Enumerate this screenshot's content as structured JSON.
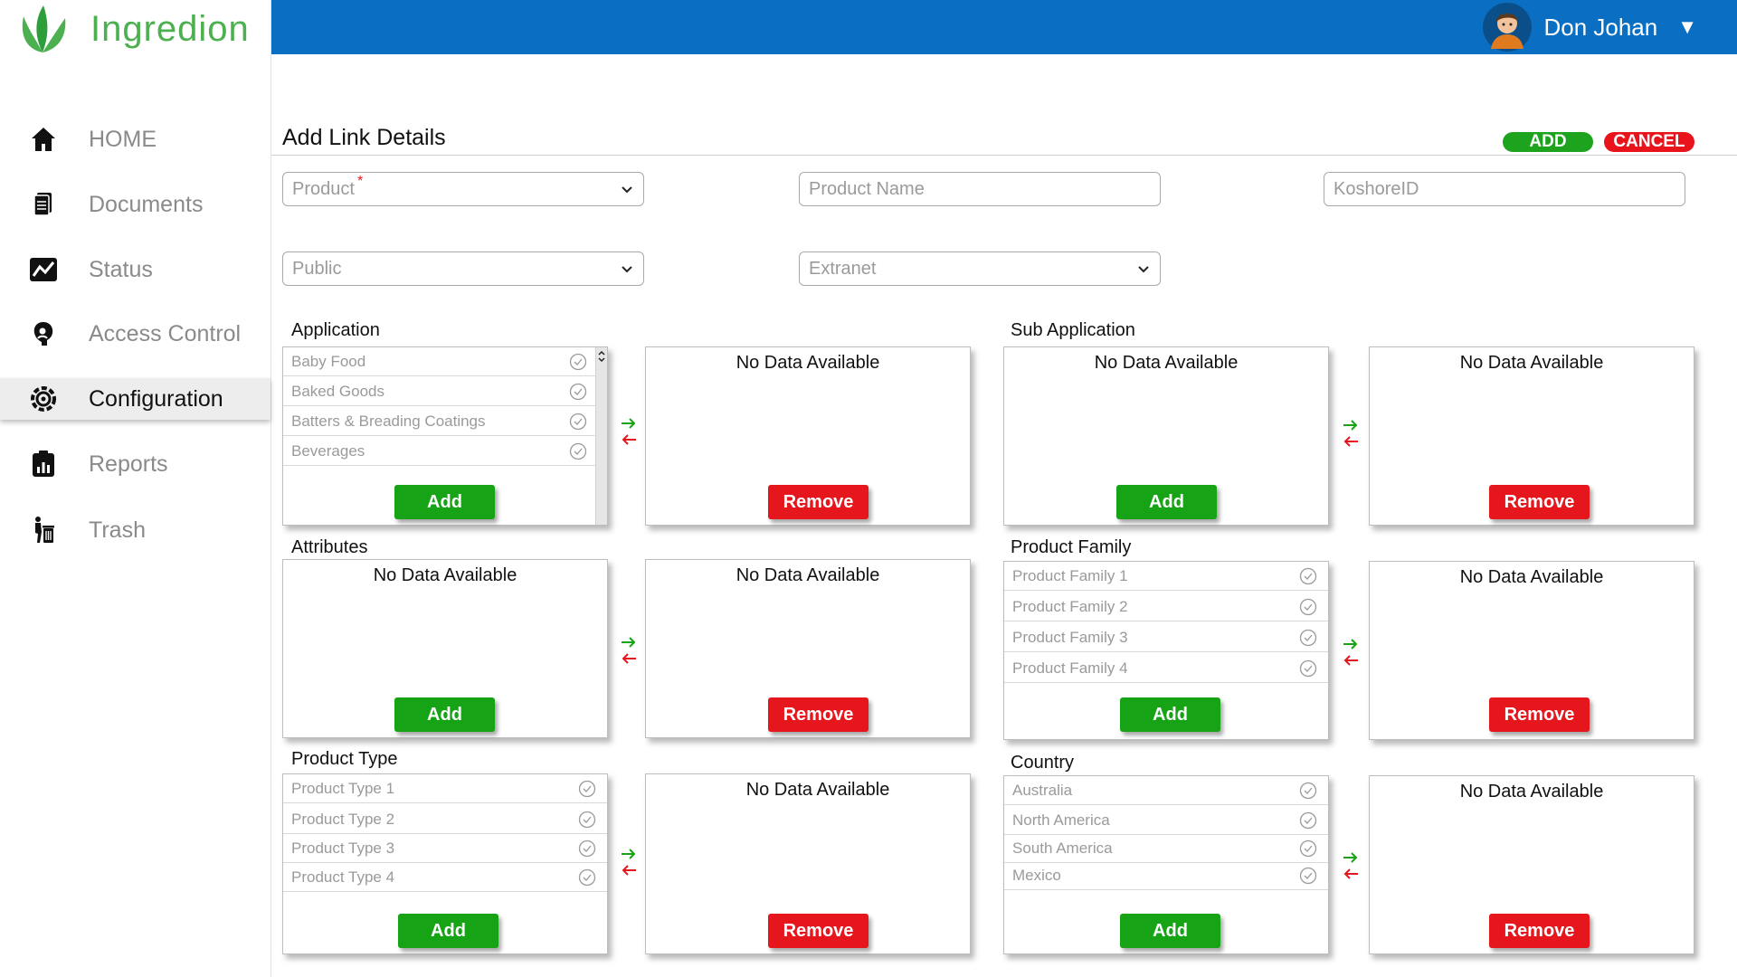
{
  "app": {
    "brand": "Ingredion"
  },
  "user": {
    "name": "Don Johan"
  },
  "sidebar": {
    "items": [
      {
        "label": "HOME",
        "icon": "home-icon"
      },
      {
        "label": "Documents",
        "icon": "document-icon"
      },
      {
        "label": "Status",
        "icon": "status-chart-icon"
      },
      {
        "label": "Access Control",
        "icon": "access-control-icon"
      },
      {
        "label": "Configuration",
        "icon": "gear-icon",
        "active": true
      },
      {
        "label": "Reports",
        "icon": "reports-icon"
      },
      {
        "label": "Trash",
        "icon": "trash-icon"
      }
    ]
  },
  "page": {
    "title": "Add Link Details",
    "add_label": "ADD",
    "cancel_label": "CANCEL"
  },
  "form": {
    "product_placeholder": "Product",
    "product_required_mark": "*",
    "product_name_placeholder": "Product Name",
    "koshore_placeholder": "KoshoreID",
    "public_value": "Public",
    "extranet_value": "Extranet"
  },
  "common": {
    "no_data": "No Data Available",
    "add": "Add",
    "remove": "Remove"
  },
  "sections": {
    "application": {
      "label": "Application",
      "items": [
        "Baby Food",
        "Baked Goods",
        "Batters & Breading Coatings",
        "Beverages"
      ]
    },
    "sub_application": {
      "label": "Sub Application"
    },
    "attributes": {
      "label": "Attributes"
    },
    "product_family": {
      "label": "Product Family",
      "items": [
        "Product Family 1",
        "Product Family 2",
        "Product Family 3",
        "Product Family 4"
      ]
    },
    "product_type": {
      "label": "Product Type",
      "items": [
        "Product Type 1",
        "Product Type 2",
        "Product Type 3",
        "Product Type 4"
      ]
    },
    "country": {
      "label": "Country",
      "items": [
        "Australia",
        "North America",
        "South America",
        "Mexico"
      ]
    }
  },
  "colors": {
    "topbar": "#0a6fc2",
    "brand_green": "#4caf50",
    "add_green": "#16a316",
    "remove_red": "#e6161d",
    "arrow_green": "#16a316",
    "arrow_red": "#e6161d"
  }
}
